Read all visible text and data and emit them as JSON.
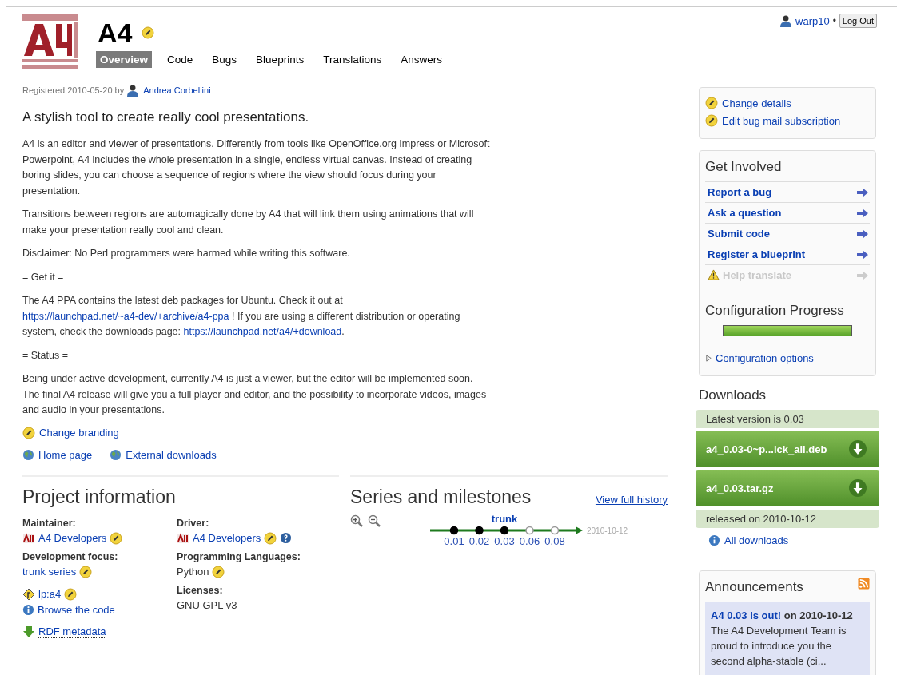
{
  "user": {
    "name": "warp10",
    "separator": "•",
    "logout": "Log Out"
  },
  "project": {
    "title": "A4",
    "tabs": [
      {
        "label": "Overview",
        "selected": true
      },
      {
        "label": "Code",
        "selected": false
      },
      {
        "label": "Bugs",
        "selected": false
      },
      {
        "label": "Blueprints",
        "selected": false
      },
      {
        "label": "Translations",
        "selected": false
      },
      {
        "label": "Answers",
        "selected": false
      }
    ],
    "registered": "Registered 2010-05-20 by",
    "owner": "Andrea Corbellini"
  },
  "summary": "A stylish tool to create really cool presentations.",
  "description": [
    [
      {
        "text": "A4 is an editor and viewer of presentations. Differently from tools like OpenOffice.org Impress or Microsoft Powerpoint, A4 includes the whole presentation in a single, endless virtual canvas. Instead of creating boring slides, you can choose a sequence of regions where the view should focus during your presentation.",
        "link": false
      }
    ],
    [
      {
        "text": "Transitions between regions are automagically done by A4 that will link them using animations that will make your presentation really cool and clean.",
        "link": false
      }
    ],
    [
      {
        "text": "Disclaimer: No Perl programmers were harmed while writing this software.",
        "link": false
      }
    ],
    [
      {
        "text": "= Get it =",
        "link": false
      }
    ],
    [
      {
        "text": "The A4 PPA contains the latest deb packages for Ubuntu. Check it out at ",
        "link": false
      },
      {
        "text": "https://launchpad.net/~a4-dev/+archive/a4-ppa",
        "link": true
      },
      {
        "text": " ! If you are using a different distribution or operating system, check the downloads page: ",
        "link": false
      },
      {
        "text": "https://launchpad.net/a4/+download",
        "link": true
      },
      {
        "text": ".",
        "link": false
      }
    ],
    [
      {
        "text": "= Status =",
        "link": false
      }
    ],
    [
      {
        "text": "Being under active development, currently A4 is just a viewer, but the editor will be implemented soon. The final A4 release will give you a full player and editor, and the possibility to incorporate videos, images and audio in your presentations.",
        "link": false
      }
    ]
  ],
  "branding_link": "Change branding",
  "links": [
    "Home page",
    "External downloads"
  ],
  "project_information": {
    "title": "Project information",
    "maintainer": {
      "label": "Maintainer:",
      "value": "A4 Developers"
    },
    "driver": {
      "label": "Driver:",
      "value": "A4 Developers"
    },
    "development_focus": {
      "label": "Development focus:",
      "value": "trunk series"
    },
    "languages": {
      "label": "Programming Languages:",
      "value": "Python"
    },
    "branch": "lp:a4",
    "browse": "Browse the code",
    "licenses": {
      "label": "Licenses:",
      "value": "GNU GPL v3"
    },
    "rdf": "RDF metadata"
  },
  "series": {
    "title": "Series and milestones",
    "history": "View full history",
    "name": "trunk",
    "date": "2010-10-12",
    "milestones": [
      {
        "name": "0.01",
        "released": true
      },
      {
        "name": "0.02",
        "released": true
      },
      {
        "name": "0.03",
        "released": true
      },
      {
        "name": "0.06",
        "released": false
      },
      {
        "name": "0.08",
        "released": false
      }
    ]
  },
  "actions": [
    "Change details",
    "Edit bug mail subscription"
  ],
  "get_involved": {
    "title": "Get Involved",
    "items": [
      {
        "label": "Report a bug",
        "disabled": false
      },
      {
        "label": "Ask a question",
        "disabled": false
      },
      {
        "label": "Submit code",
        "disabled": false
      },
      {
        "label": "Register a blueprint",
        "disabled": false
      },
      {
        "label": "Help translate",
        "disabled": true
      }
    ]
  },
  "configuration": {
    "title": "Configuration Progress",
    "level": 1.0,
    "options": "Configuration options",
    "expanded": false
  },
  "downloads": {
    "title": "Downloads",
    "latest": "Latest version is 0.03",
    "files": [
      "a4_0.03-0~p...ick_all.deb",
      "a4_0.03.tar.gz"
    ],
    "released": "released on 2010-10-12",
    "all": "All downloads"
  },
  "announcements": {
    "title": "Announcements",
    "items": [
      {
        "title": "A4 0.03 is out!",
        "date": "on 2010-10-12",
        "text": "The A4 Development Team is proud to introduce you the second alpha-stable (ci..."
      }
    ]
  }
}
